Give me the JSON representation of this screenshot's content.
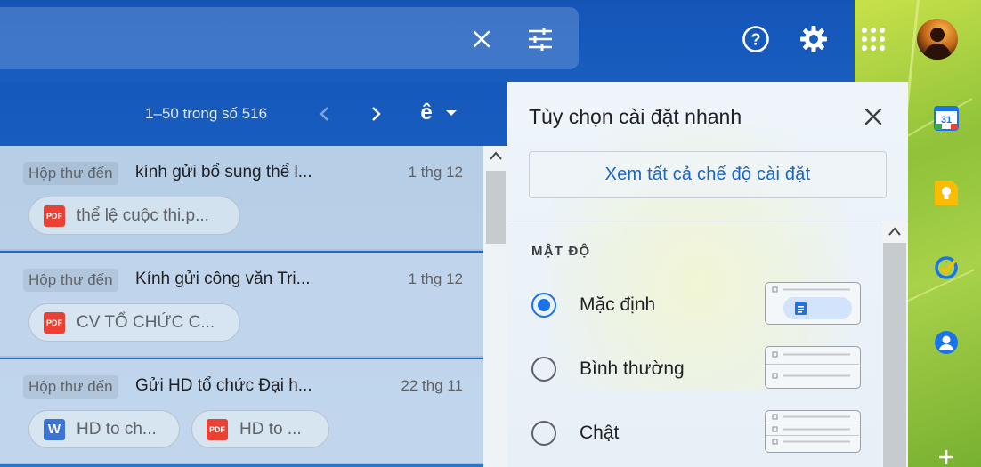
{
  "header": {
    "icons": [
      "clear-search-icon",
      "search-options-icon",
      "help-icon",
      "settings-icon",
      "apps-icon",
      "avatar"
    ]
  },
  "toolbar": {
    "pager_text": "1–50 trong số 516",
    "input_tool_label": "ê"
  },
  "mail_list": {
    "rows": [
      {
        "tag": "Hộp thư đến",
        "subject": "kính gửi bổ sung thể l...",
        "date": "1 thg 12",
        "attachments": [
          {
            "type": "PDF",
            "name": "thể lệ cuộc thi.p..."
          }
        ]
      },
      {
        "tag": "Hộp thư đến",
        "subject": "Kính gửi công văn Tri...",
        "date": "1 thg 12",
        "attachments": [
          {
            "type": "PDF",
            "name": "CV TỔ CHỨC C..."
          }
        ]
      },
      {
        "tag": "Hộp thư đến",
        "subject": "Gửi HD tổ chức Đại h...",
        "date": "22 thg 11",
        "attachments": [
          {
            "type": "W",
            "name": "HD to ch..."
          },
          {
            "type": "PDF",
            "name": "HD to ..."
          }
        ]
      }
    ]
  },
  "quick_settings": {
    "title": "Tùy chọn cài đặt nhanh",
    "view_all_label": "Xem tất cả chế độ cài đặt",
    "density_title": "MẬT ĐỘ",
    "density_options": [
      {
        "label": "Mặc định",
        "selected": true
      },
      {
        "label": "Bình thường",
        "selected": false
      },
      {
        "label": "Chật",
        "selected": false
      }
    ]
  },
  "side_panel": {
    "apps": [
      "calendar-icon",
      "keep-icon",
      "tasks-icon",
      "contacts-icon",
      "add-icon"
    ],
    "calendar_day": "31"
  },
  "colors": {
    "accent": "#1a73e8",
    "link": "#1a66c9",
    "pdf": "#e94235",
    "word": "#3b74d4"
  }
}
